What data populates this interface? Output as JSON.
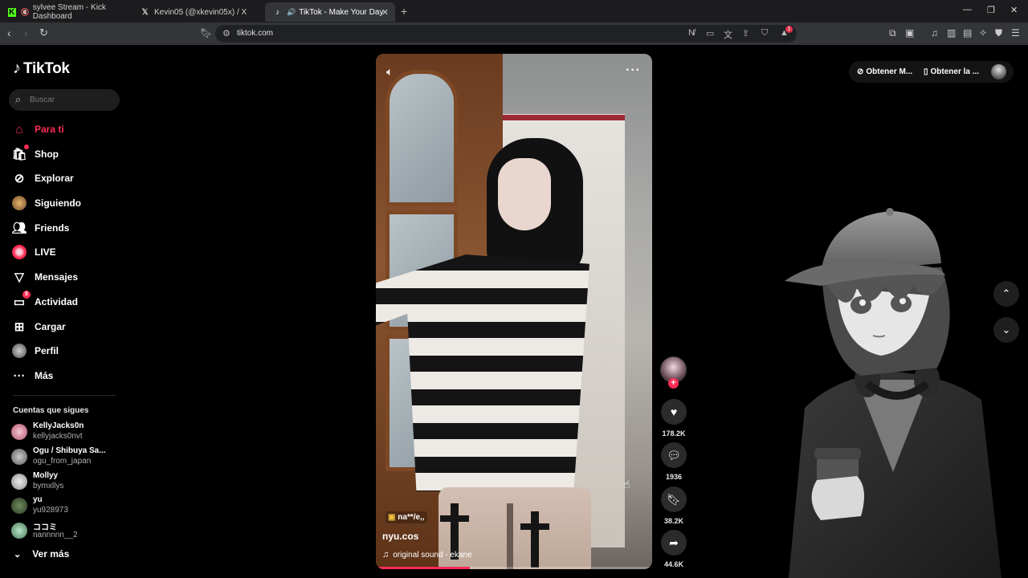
{
  "browser": {
    "tabs": [
      {
        "title": "sylvee Stream - Kick Dashboard",
        "icon": "kick-icon",
        "active": false
      },
      {
        "title": "Kevin05 (@xkevin05x) / X",
        "icon": "x-icon",
        "active": false
      },
      {
        "title": "TikTok - Make Your Day",
        "icon": "tiktok-icon",
        "active": true
      }
    ],
    "url": "tiktok.com",
    "extension_badge": "1"
  },
  "sidebar": {
    "logo": "TikTok",
    "search_placeholder": "Buscar",
    "nav": [
      {
        "label": "Para ti",
        "icon": "home-icon",
        "active": true
      },
      {
        "label": "Shop",
        "icon": "shop-icon"
      },
      {
        "label": "Explorar",
        "icon": "compass-icon"
      },
      {
        "label": "Siguiendo",
        "icon": "following-avatar-icon"
      },
      {
        "label": "Friends",
        "icon": "friends-icon"
      },
      {
        "label": "LIVE",
        "icon": "live-icon"
      },
      {
        "label": "Mensajes",
        "icon": "messages-icon"
      },
      {
        "label": "Actividad",
        "icon": "activity-icon",
        "badge": "5"
      },
      {
        "label": "Cargar",
        "icon": "upload-icon"
      },
      {
        "label": "Perfil",
        "icon": "profile-avatar-icon"
      },
      {
        "label": "Más",
        "icon": "more-icon"
      }
    ],
    "following_title": "Cuentas que sigues",
    "following": [
      {
        "name": "KellyJacks0n",
        "user": "kellyjacks0nvt"
      },
      {
        "name": "Ogu / Shibuya Sa...",
        "user": "ogu_from_japan"
      },
      {
        "name": "Mollyy",
        "user": "bymxllys"
      },
      {
        "name": "yu",
        "user": "yu928973"
      },
      {
        "name": "ココミ",
        "user": "nannnnn__2"
      }
    ],
    "see_more": "Ver más"
  },
  "video": {
    "tag": "na**/e,,",
    "author": "nyu.cos",
    "sound": "original sound - ekane",
    "progress": 0.34
  },
  "actions": {
    "likes": "178.2K",
    "comments": "1936",
    "saves": "38.2K",
    "shares": "44.6K"
  },
  "top_right": {
    "item1": "Obtener M...",
    "item2": "Obtener la ..."
  },
  "colors": {
    "accent": "#fe2c55",
    "background": "#000000"
  }
}
